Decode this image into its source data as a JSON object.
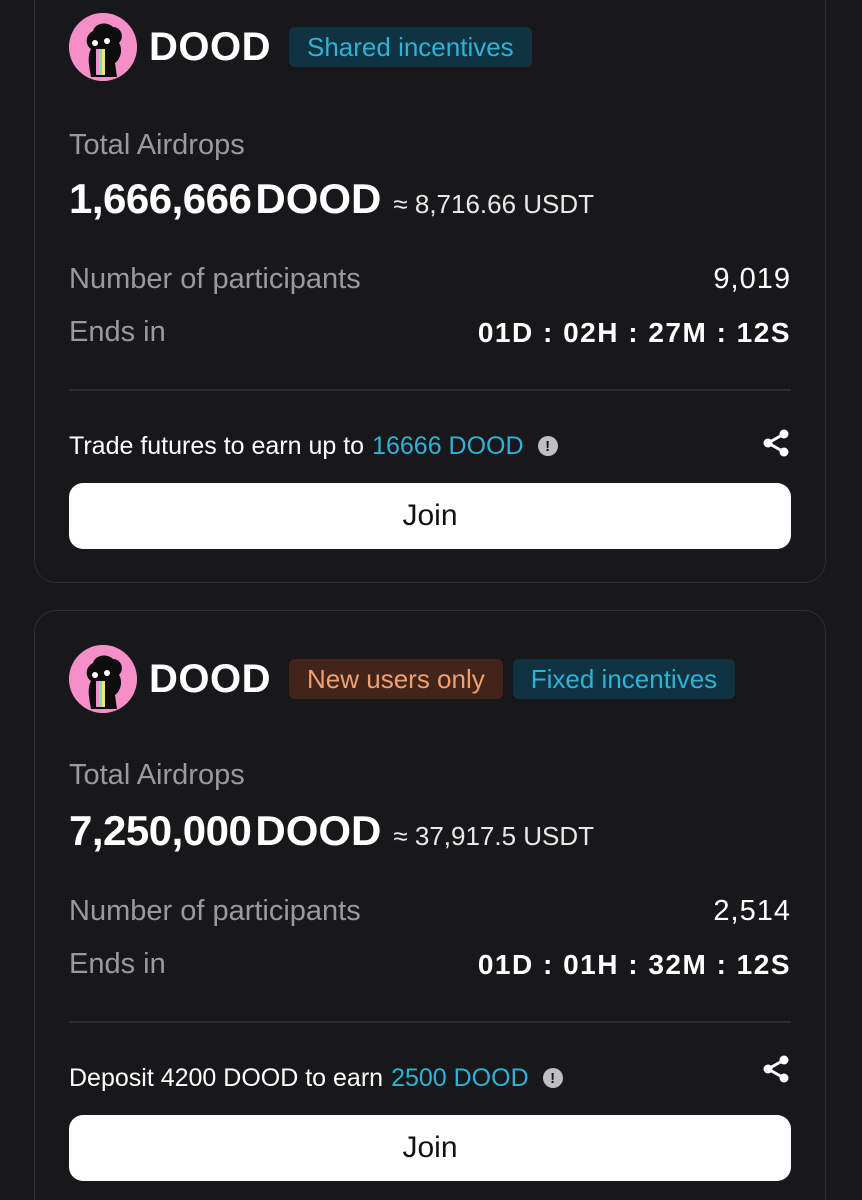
{
  "cards": [
    {
      "token": "DOOD",
      "badges": [
        {
          "label": "Shared incentives",
          "color": "#2fb2d6"
        }
      ],
      "total_label": "Total Airdrops",
      "amount": "1,666,666",
      "amount_unit": "DOOD",
      "approx": "≈ 8,716.66 USDT",
      "participants_label": "Number of participants",
      "participants": "9,019",
      "ends_label": "Ends in",
      "ends_in": "01D : 02H : 27M : 12S",
      "task_text": "Trade futures to earn up to",
      "task_reward": "16666 DOOD",
      "join_label": "Join",
      "info_icon": "info-icon",
      "share_icon": "share-icon"
    },
    {
      "token": "DOOD",
      "badges": [
        {
          "label": "New users only",
          "color": "#f0a070"
        },
        {
          "label": "Fixed incentives",
          "color": "#2fb2d6"
        }
      ],
      "total_label": "Total Airdrops",
      "amount": "7,250,000",
      "amount_unit": "DOOD",
      "approx": "≈ 37,917.5 USDT",
      "participants_label": "Number of participants",
      "participants": "2,514",
      "ends_label": "Ends in",
      "ends_in": "01D : 01H : 32M : 12S",
      "task_text": "Deposit 4200 DOOD to earn",
      "task_reward": "2500 DOOD",
      "join_label": "Join",
      "info_icon": "info-icon",
      "share_icon": "share-icon"
    }
  ],
  "colors": {
    "background": "#18181a",
    "accent": "#2fb2d6",
    "avatar_bg": "#f58fc7"
  }
}
